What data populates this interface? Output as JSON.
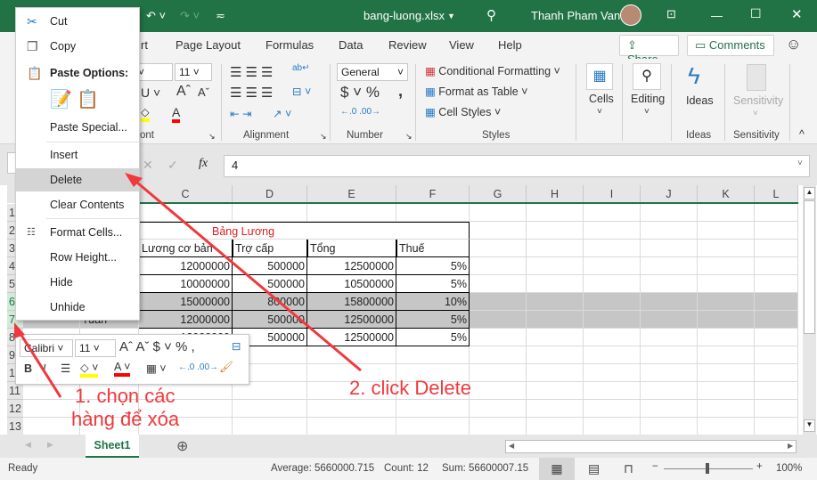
{
  "title_bar": {
    "filename": "bang-luong.xlsx",
    "user": "Thanh Pham Van",
    "colors": {
      "brand": "#217346"
    }
  },
  "ribbon_tabs": [
    "rt",
    "Page Layout",
    "Formulas",
    "Data",
    "Review",
    "View",
    "Help"
  ],
  "share_label": "Share",
  "comments_label": "Comments",
  "ribbon": {
    "font_size": "11",
    "number_format": "General",
    "conditional_formatting": "Conditional Formatting",
    "format_as_table": "Format as Table",
    "cell_styles": "Cell Styles",
    "cells": "Cells",
    "editing": "Editing",
    "ideas": "Ideas",
    "sensitivity": "Sensitivity",
    "groups": {
      "font": "ont",
      "alignment": "Alignment",
      "number": "Number",
      "styles": "Styles",
      "ideas": "Ideas",
      "sensitivity": "Sensitivity"
    }
  },
  "formula_bar": {
    "fx": "fx",
    "value": "4"
  },
  "columns": [
    "C",
    "D",
    "E",
    "F",
    "G",
    "H",
    "I",
    "J",
    "K",
    "L"
  ],
  "rows": [
    "1",
    "2",
    "3",
    "4",
    "5",
    "6",
    "7",
    "8",
    "9",
    "10",
    "11",
    "12",
    "13"
  ],
  "table": {
    "title": "Bảng Lương",
    "headers": [
      "Lương cơ bản",
      "Trợ cấp",
      "Tổng",
      "Thuế"
    ],
    "rows": [
      [
        "12000000",
        "500000",
        "12500000",
        "5%"
      ],
      [
        "10000000",
        "500000",
        "10500000",
        "5%"
      ],
      [
        "15000000",
        "800000",
        "15800000",
        "10%"
      ],
      [
        "12000000",
        "500000",
        "12500000",
        "5%"
      ],
      [
        "12000000",
        "500000",
        "12500000",
        "5%"
      ]
    ],
    "partial_cell_b7": "Tuan"
  },
  "context_menu": {
    "cut": "Cut",
    "copy": "Copy",
    "paste_options": "Paste Options:",
    "paste_special": "Paste Special...",
    "insert": "Insert",
    "delete": "Delete",
    "clear_contents": "Clear Contents",
    "format_cells": "Format Cells...",
    "row_height": "Row Height...",
    "hide": "Hide",
    "unhide": "Unhide"
  },
  "mini_toolbar": {
    "font": "Calibri",
    "size": "11"
  },
  "sheet_tab": "Sheet1",
  "status": {
    "ready": "Ready",
    "average": "Average: 5660000.715",
    "count": "Count: 12",
    "sum": "Sum: 56600007.15",
    "zoom": "100%"
  },
  "annotations": {
    "step1_line1": "1. chọn các",
    "step1_line2": "hàng để xóa",
    "step2": "2. click Delete"
  }
}
